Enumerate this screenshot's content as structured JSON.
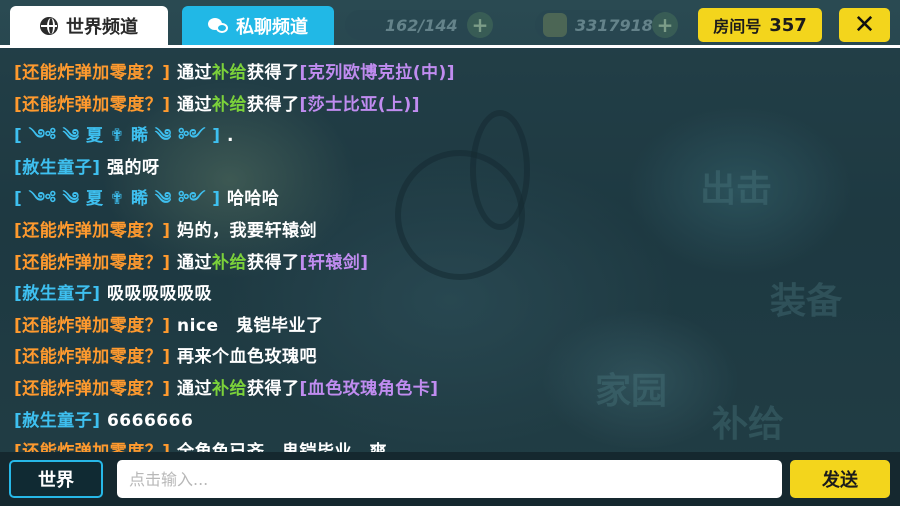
{
  "tabs": {
    "world": "世界频道",
    "private": "私聊频道"
  },
  "hud": {
    "stamina": "162/144",
    "coins": "3317918",
    "plus": "+"
  },
  "room": {
    "label": "房间号",
    "number": "357"
  },
  "close_glyph": "✕",
  "background_badges": [
    "出击",
    "装备",
    "家园",
    "补给"
  ],
  "messages": [
    {
      "name": "[还能炸弹加零度？]",
      "name_color": "orange",
      "parts": [
        {
          "t": "通过",
          "c": "white"
        },
        {
          "t": "补给",
          "c": "green"
        },
        {
          "t": "获得了",
          "c": "white"
        },
        {
          "t": "[克列欧博克拉(中)]",
          "c": "purple"
        }
      ]
    },
    {
      "name": "[还能炸弹加零度？]",
      "name_color": "orange",
      "parts": [
        {
          "t": "通过",
          "c": "white"
        },
        {
          "t": "补给",
          "c": "green"
        },
        {
          "t": "获得了",
          "c": "white"
        },
        {
          "t": "[莎士比亚(上)]",
          "c": "purple"
        }
      ]
    },
    {
      "name": "[ ༺ ༄ 夏 ✟ 睎 ༄ ༻ ]",
      "name_color": "fancy",
      "parts": [
        {
          "t": ".",
          "c": "white"
        }
      ]
    },
    {
      "name": "[赦生童子]",
      "name_color": "blue",
      "parts": [
        {
          "t": "强的呀",
          "c": "white"
        }
      ]
    },
    {
      "name": "[ ༺ ༄ 夏 ✟ 睎 ༄ ༻ ]",
      "name_color": "fancy",
      "parts": [
        {
          "t": "哈哈哈",
          "c": "white"
        }
      ]
    },
    {
      "name": "[还能炸弹加零度？]",
      "name_color": "orange",
      "parts": [
        {
          "t": "妈的，我要轩辕剑",
          "c": "white"
        }
      ]
    },
    {
      "name": "[还能炸弹加零度？]",
      "name_color": "orange",
      "parts": [
        {
          "t": "通过",
          "c": "white"
        },
        {
          "t": "补给",
          "c": "green"
        },
        {
          "t": "获得了",
          "c": "white"
        },
        {
          "t": "[轩辕剑]",
          "c": "purple"
        }
      ]
    },
    {
      "name": "[赦生童子]",
      "name_color": "blue",
      "parts": [
        {
          "t": "吸吸吸吸吸吸",
          "c": "white"
        }
      ]
    },
    {
      "name": "[还能炸弹加零度？]",
      "name_color": "orange",
      "parts": [
        {
          "t": "nice　鬼铠毕业了",
          "c": "white"
        }
      ]
    },
    {
      "name": "[还能炸弹加零度？]",
      "name_color": "orange",
      "parts": [
        {
          "t": "再来个血色玫瑰吧",
          "c": "white"
        }
      ]
    },
    {
      "name": "[还能炸弹加零度？]",
      "name_color": "orange",
      "parts": [
        {
          "t": "通过",
          "c": "white"
        },
        {
          "t": "补给",
          "c": "green"
        },
        {
          "t": "获得了",
          "c": "white"
        },
        {
          "t": "[血色玫瑰角色卡]",
          "c": "purple"
        }
      ]
    },
    {
      "name": "[赦生童子]",
      "name_color": "blue",
      "parts": [
        {
          "t": "6666666",
          "c": "white"
        }
      ]
    },
    {
      "name": "[还能炸弹加零度？]",
      "name_color": "orange",
      "parts": [
        {
          "t": "全角色已齐，鬼铠毕业，爽",
          "c": "white"
        }
      ]
    }
  ],
  "bottom": {
    "channel_button": "世界",
    "input_placeholder": "点击输入...",
    "input_value": "",
    "send_button": "发送"
  },
  "colors": {
    "orange": "#ff9a2e",
    "blue": "#3ec0f0",
    "green": "#7bd13a",
    "purple": "#c08cf0",
    "white": "#ffffff",
    "yellow_button": "#f3d51c",
    "tab_active_blue": "#21b8e6"
  }
}
